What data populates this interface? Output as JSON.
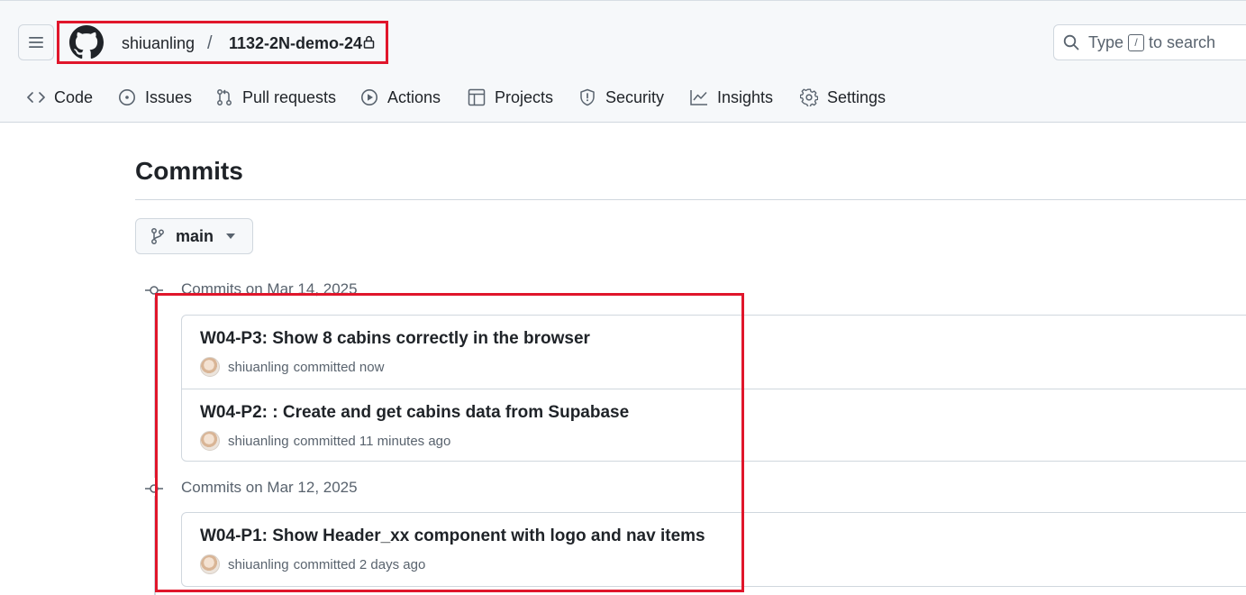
{
  "header": {
    "owner": "shiuanling",
    "separator": "/",
    "repo": "1132-2N-demo-24",
    "search": {
      "prefix": "Type",
      "key": "/",
      "suffix": "to search"
    }
  },
  "tabs": [
    {
      "label": "Code",
      "icon": "code-icon"
    },
    {
      "label": "Issues",
      "icon": "issue-icon"
    },
    {
      "label": "Pull requests",
      "icon": "pull-request-icon"
    },
    {
      "label": "Actions",
      "icon": "play-icon"
    },
    {
      "label": "Projects",
      "icon": "table-icon"
    },
    {
      "label": "Security",
      "icon": "shield-icon"
    },
    {
      "label": "Insights",
      "icon": "graph-icon"
    },
    {
      "label": "Settings",
      "icon": "gear-icon"
    }
  ],
  "page": {
    "title": "Commits"
  },
  "branch": {
    "name": "main"
  },
  "groups": [
    {
      "heading": "Commits on Mar 14, 2025",
      "commits": [
        {
          "title": "W04-P3: Show 8 cabins correctly in the browser",
          "author": "shiuanling",
          "action": "committed now"
        },
        {
          "title": "W04-P2: : Create and get cabins data from Supabase",
          "author": "shiuanling",
          "action": "committed 11 minutes ago"
        }
      ]
    },
    {
      "heading": "Commits on Mar 12, 2025",
      "commits": [
        {
          "title": "W04-P1: Show Header_xx component with logo and nav items",
          "author": "shiuanling",
          "action": "committed 2 days ago"
        }
      ]
    }
  ],
  "colors": {
    "highlight": "#e0162b",
    "text": "#1f2328",
    "muted": "#59636e",
    "border": "#d0d7de"
  }
}
